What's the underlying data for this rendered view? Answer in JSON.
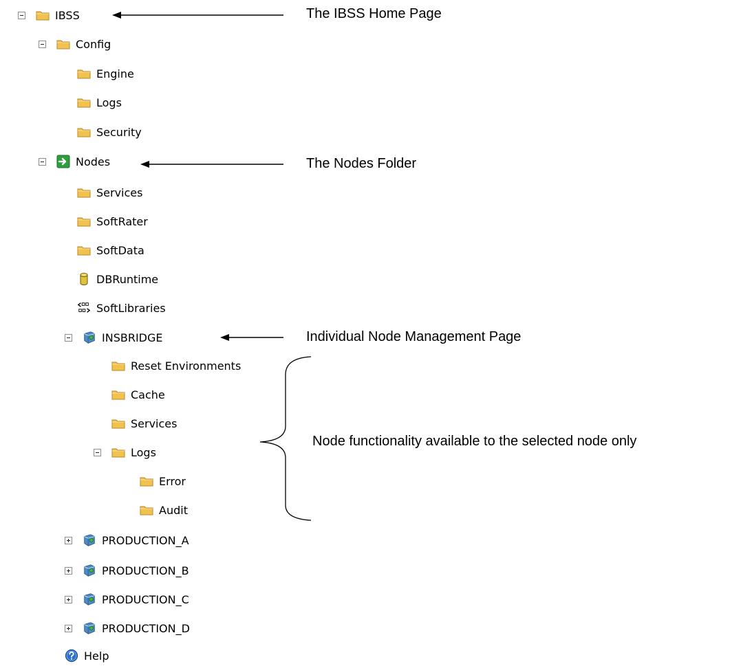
{
  "tree": {
    "root": {
      "label": "IBSS",
      "icon": "folder-icon",
      "state": "expanded"
    },
    "config": {
      "label": "Config",
      "icon": "folder-icon",
      "state": "expanded"
    },
    "engine": {
      "label": "Engine",
      "icon": "folder-icon"
    },
    "logs": {
      "label": "Logs",
      "icon": "folder-icon"
    },
    "security": {
      "label": "Security",
      "icon": "folder-icon"
    },
    "nodes": {
      "label": "Nodes",
      "icon": "green-arrow-icon",
      "state": "expanded"
    },
    "services": {
      "label": "Services",
      "icon": "folder-icon"
    },
    "softrater": {
      "label": "SoftRater",
      "icon": "folder-icon"
    },
    "softdata": {
      "label": "SoftData",
      "icon": "folder-icon"
    },
    "dbruntime": {
      "label": "DBRuntime",
      "icon": "database-icon"
    },
    "softlibraries": {
      "label": "SoftLibraries",
      "icon": "library-icon"
    },
    "insbridge": {
      "label": "INSBRIDGE",
      "icon": "server-icon",
      "state": "expanded"
    },
    "reset_env": {
      "label": "Reset Environments",
      "icon": "folder-icon"
    },
    "cache": {
      "label": "Cache",
      "icon": "folder-icon"
    },
    "node_services": {
      "label": "Services",
      "icon": "folder-icon"
    },
    "node_logs": {
      "label": "Logs",
      "icon": "folder-icon",
      "state": "expanded"
    },
    "error": {
      "label": "Error",
      "icon": "folder-icon"
    },
    "audit": {
      "label": "Audit",
      "icon": "folder-icon"
    },
    "production_a": {
      "label": "PRODUCTION_A",
      "icon": "server-icon",
      "state": "collapsed"
    },
    "production_b": {
      "label": "PRODUCTION_B",
      "icon": "server-icon",
      "state": "collapsed"
    },
    "production_c": {
      "label": "PRODUCTION_C",
      "icon": "server-icon",
      "state": "collapsed"
    },
    "production_d": {
      "label": "PRODUCTION_D",
      "icon": "server-icon",
      "state": "collapsed"
    },
    "help": {
      "label": "Help",
      "icon": "help-icon"
    }
  },
  "annotations": {
    "home": "The IBSS Home Page",
    "nodes_folder": "The Nodes Folder",
    "node_mgmt": "Individual Node Management Page",
    "node_functionality": "Node functionality available to the selected node only"
  },
  "colors": {
    "folder": "#f2c24e",
    "arrow_green": "#2e9e3c",
    "server_blue": "#4d8cc8",
    "help_blue": "#2a6fc9"
  }
}
